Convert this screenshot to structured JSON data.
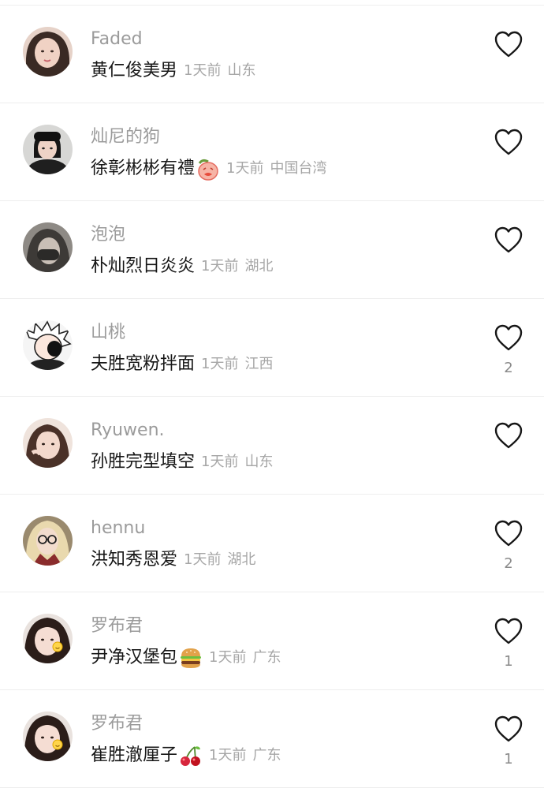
{
  "comments": [
    {
      "username": "Faded",
      "text": "黄仁俊美男",
      "time": "1天前",
      "location": "山东",
      "likes": "",
      "avatar_color": "#d9a9a2"
    },
    {
      "username": "灿尼的狗",
      "text": "徐彰彬彬有禮",
      "time": "1天前",
      "location": "中国台湾",
      "likes": "",
      "emoji": "peach-face-icon",
      "avatar_color": "#2a2a2a"
    },
    {
      "username": "泡泡",
      "text": "朴灿烈日炎炎",
      "time": "1天前",
      "location": "湖北",
      "likes": "",
      "avatar_color": "#4f4d4a"
    },
    {
      "username": "山桃",
      "text": "夫胜宽粉拌面",
      "time": "1天前",
      "location": "江西",
      "likes": "2",
      "avatar_color": "#f2f2f2"
    },
    {
      "username": "Ryuwen.",
      "text": "孙胜完型填空",
      "time": "1天前",
      "location": "山东",
      "likes": "",
      "avatar_color": "#c9b2a6"
    },
    {
      "username": "hennu",
      "text": "洪知秀恩爱",
      "time": "1天前",
      "location": "湖北",
      "likes": "2",
      "avatar_color": "#d8c9a8"
    },
    {
      "username": "罗布君",
      "text": "尹净汉堡包",
      "time": "1天前",
      "location": "广东",
      "likes": "1",
      "emoji": "hamburger-icon",
      "avatar_color": "#3a2a25"
    },
    {
      "username": "罗布君",
      "text": "崔胜澈厘子",
      "time": "1天前",
      "location": "广东",
      "likes": "1",
      "emoji": "cherries-icon",
      "avatar_color": "#3a2a25"
    }
  ]
}
